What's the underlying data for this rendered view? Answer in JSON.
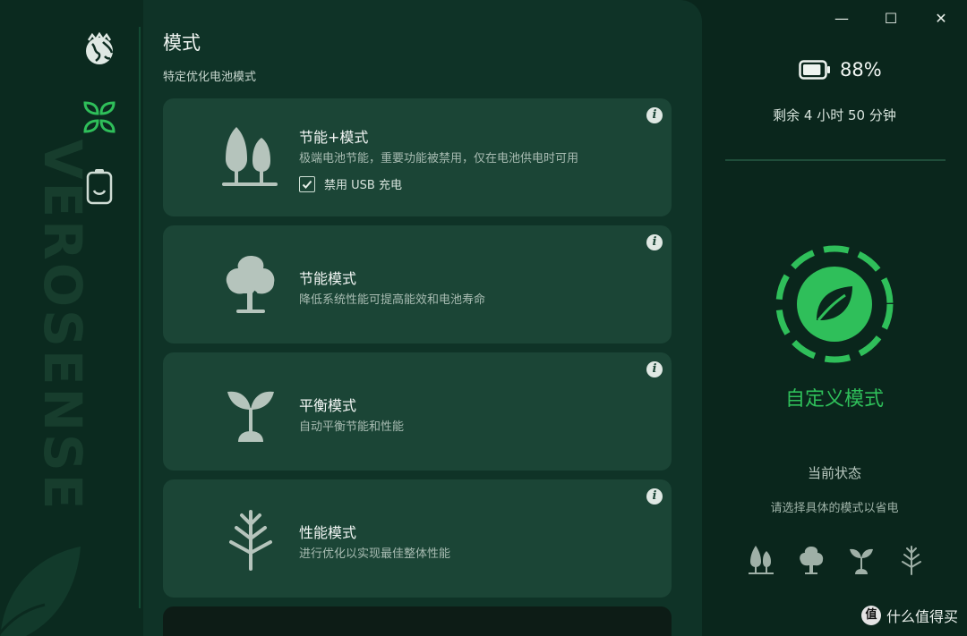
{
  "rail": {
    "brand_text": "VEROSENSE",
    "nav": [
      {
        "icon": "globe-icon",
        "selected": false
      },
      {
        "icon": "leaves-icon",
        "selected": true
      },
      {
        "icon": "battery-icon",
        "selected": false
      }
    ]
  },
  "panel": {
    "title": "模式",
    "subtitle": "特定优化电池模式",
    "cards": [
      {
        "title": "节能+模式",
        "desc": "极端电池节能，重要功能被禁用，仅在电池供电时可用",
        "checkbox": {
          "label": "禁用 USB 充电",
          "checked": true
        }
      },
      {
        "title": "节能模式",
        "desc": "降低系统性能可提高能效和电池寿命"
      },
      {
        "title": "平衡模式",
        "desc": "自动平衡节能和性能"
      },
      {
        "title": "性能模式",
        "desc": "进行优化以实现最佳整体性能"
      }
    ],
    "info_glyph": "i"
  },
  "status": {
    "battery_percent": "88%",
    "battery_level": 0.88,
    "remaining": "剩余 4 小时 50 分钟",
    "mode_name": "自定义模式",
    "current_state_label": "当前状态",
    "hint": "请选择具体的模式以省电"
  },
  "window": {
    "minimize": "—",
    "maximize": "☐",
    "close": "✕"
  },
  "watermark": {
    "badge": "值",
    "text": "什么值得买"
  },
  "colors": {
    "accent": "#2fbf5a",
    "panel": "#0f3327",
    "card": "#1b4536",
    "background": "#0a261c"
  }
}
